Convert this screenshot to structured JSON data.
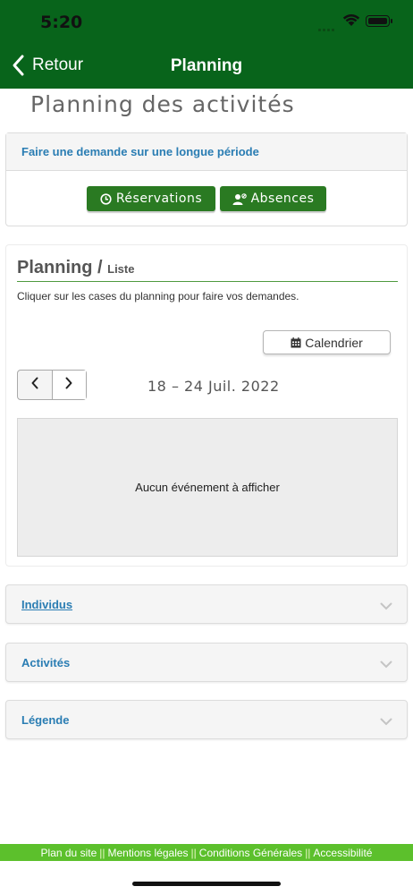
{
  "status_bar": {
    "time": "5:20"
  },
  "nav": {
    "back_label": "Retour",
    "title": "Planning"
  },
  "page_title": "Planning des activités",
  "request_card": {
    "title": "Faire une demande sur une longue période",
    "reservations_label": "Réservations",
    "absences_label": "Absences"
  },
  "planning": {
    "title": "Planning /",
    "subtitle": "Liste",
    "description": "Cliquer sur les cases du planning pour faire vos demandes.",
    "calendar_label": "Calendrier",
    "date_range": "18 – 24 Juil. 2022",
    "empty_message": "Aucun événement à afficher"
  },
  "accordions": [
    {
      "label": "Individus"
    },
    {
      "label": "Activités"
    },
    {
      "label": "Légende"
    }
  ],
  "footer": {
    "links": [
      "Plan du site",
      "Mentions légales",
      "Conditions Générales",
      "Accessibilité"
    ],
    "separator": "||"
  },
  "colors": {
    "header_green": "#08641b",
    "button_green": "#2a7a22",
    "footer_green": "#5cc02c",
    "link_blue": "#2a7db3"
  },
  "icons": {
    "back": "chevron-left-icon",
    "reservations": "clock-icon",
    "absences": "user-off-icon",
    "calendar": "calendar-icon",
    "prev": "chevron-left-icon",
    "next": "chevron-right-icon",
    "accordion": "chevron-down-icon"
  }
}
